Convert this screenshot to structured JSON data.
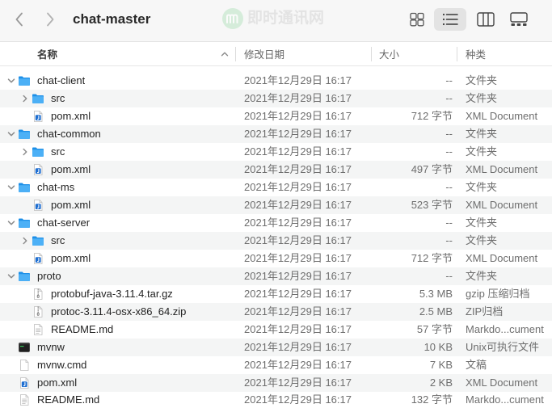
{
  "window": {
    "title": "chat-master"
  },
  "toolbar": {
    "back_icon": "chevron-left-icon",
    "forward_icon": "chevron-right-icon",
    "views": [
      {
        "icon": "grid-icon",
        "selected": false
      },
      {
        "icon": "list-icon",
        "selected": true
      },
      {
        "icon": "columns-icon",
        "selected": false
      },
      {
        "icon": "gallery-icon",
        "selected": false
      }
    ]
  },
  "watermark": {
    "logo_icon": "m-logo-icon",
    "text": "即时通讯网"
  },
  "columns": {
    "name": "名称",
    "modified": "修改日期",
    "size": "大小",
    "kind": "种类"
  },
  "sort": {
    "column_index": 0,
    "ascending": true,
    "icon": "chevron-up-icon"
  },
  "rows": [
    {
      "depth": 0,
      "expandable": true,
      "expanded": true,
      "icon": "folder-icon",
      "name": "chat-client",
      "date": "2021年12月29日 16:17",
      "size": "--",
      "kind": "文件夹"
    },
    {
      "depth": 1,
      "expandable": true,
      "expanded": false,
      "icon": "folder-icon",
      "name": "src",
      "date": "2021年12月29日 16:17",
      "size": "--",
      "kind": "文件夹"
    },
    {
      "depth": 1,
      "expandable": false,
      "expanded": false,
      "icon": "xml-file-icon",
      "name": "pom.xml",
      "date": "2021年12月29日 16:17",
      "size": "712 字节",
      "kind": "XML Document"
    },
    {
      "depth": 0,
      "expandable": true,
      "expanded": true,
      "icon": "folder-icon",
      "name": "chat-common",
      "date": "2021年12月29日 16:17",
      "size": "--",
      "kind": "文件夹"
    },
    {
      "depth": 1,
      "expandable": true,
      "expanded": false,
      "icon": "folder-icon",
      "name": "src",
      "date": "2021年12月29日 16:17",
      "size": "--",
      "kind": "文件夹"
    },
    {
      "depth": 1,
      "expandable": false,
      "expanded": false,
      "icon": "xml-file-icon",
      "name": "pom.xml",
      "date": "2021年12月29日 16:17",
      "size": "497 字节",
      "kind": "XML Document"
    },
    {
      "depth": 0,
      "expandable": true,
      "expanded": true,
      "icon": "folder-icon",
      "name": "chat-ms",
      "date": "2021年12月29日 16:17",
      "size": "--",
      "kind": "文件夹"
    },
    {
      "depth": 1,
      "expandable": false,
      "expanded": false,
      "icon": "xml-file-icon",
      "name": "pom.xml",
      "date": "2021年12月29日 16:17",
      "size": "523 字节",
      "kind": "XML Document"
    },
    {
      "depth": 0,
      "expandable": true,
      "expanded": true,
      "icon": "folder-icon",
      "name": "chat-server",
      "date": "2021年12月29日 16:17",
      "size": "--",
      "kind": "文件夹"
    },
    {
      "depth": 1,
      "expandable": true,
      "expanded": false,
      "icon": "folder-icon",
      "name": "src",
      "date": "2021年12月29日 16:17",
      "size": "--",
      "kind": "文件夹"
    },
    {
      "depth": 1,
      "expandable": false,
      "expanded": false,
      "icon": "xml-file-icon",
      "name": "pom.xml",
      "date": "2021年12月29日 16:17",
      "size": "712 字节",
      "kind": "XML Document"
    },
    {
      "depth": 0,
      "expandable": true,
      "expanded": true,
      "icon": "folder-icon",
      "name": "proto",
      "date": "2021年12月29日 16:17",
      "size": "--",
      "kind": "文件夹"
    },
    {
      "depth": 1,
      "expandable": false,
      "expanded": false,
      "icon": "archive-file-icon",
      "name": "protobuf-java-3.11.4.tar.gz",
      "date": "2021年12月29日 16:17",
      "size": "5.3 MB",
      "kind": "gzip 压缩归档"
    },
    {
      "depth": 1,
      "expandable": false,
      "expanded": false,
      "icon": "archive-file-icon",
      "name": "protoc-3.11.4-osx-x86_64.zip",
      "date": "2021年12月29日 16:17",
      "size": "2.5 MB",
      "kind": "ZIP归档"
    },
    {
      "depth": 1,
      "expandable": false,
      "expanded": false,
      "icon": "text-document-icon",
      "name": "README.md",
      "date": "2021年12月29日 16:17",
      "size": "57 字节",
      "kind": "Markdo...cument"
    },
    {
      "depth": 0,
      "expandable": false,
      "expanded": false,
      "icon": "unix-executable-icon",
      "name": "mvnw",
      "date": "2021年12月29日 16:17",
      "size": "10 KB",
      "kind": "Unix可执行文件"
    },
    {
      "depth": 0,
      "expandable": false,
      "expanded": false,
      "icon": "blank-document-icon",
      "name": "mvnw.cmd",
      "date": "2021年12月29日 16:17",
      "size": "7 KB",
      "kind": "文稿"
    },
    {
      "depth": 0,
      "expandable": false,
      "expanded": false,
      "icon": "xml-file-icon",
      "name": "pom.xml",
      "date": "2021年12月29日 16:17",
      "size": "2 KB",
      "kind": "XML Document"
    },
    {
      "depth": 0,
      "expandable": false,
      "expanded": false,
      "icon": "text-document-icon",
      "name": "README.md",
      "date": "2021年12月29日 16:17",
      "size": "132 字节",
      "kind": "Markdo...cument"
    }
  ],
  "colors": {
    "toolbar_bg": "#f7f7f7",
    "row_stripe": "#f4f5f5",
    "selected_view_bg": "#e3e3e3",
    "primary_text": "#232323",
    "secondary_text": "#6e6e6e",
    "folder_front": "#4cb0f6",
    "folder_back": "#1d8fe8"
  }
}
